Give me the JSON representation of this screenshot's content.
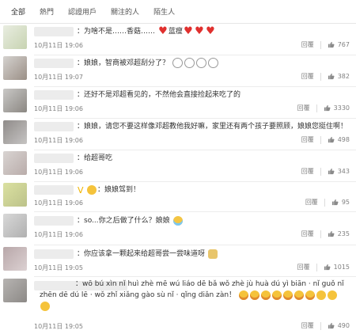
{
  "tabs": [
    "全部",
    "熱門",
    "認證用戶",
    "關注的人",
    "陌生人"
  ],
  "actions": {
    "reply_label": "回覆"
  },
  "comments": [
    {
      "text": "：为啥不是……香菇……",
      "suffix": "蓝瘦",
      "time": "10月11日 19:06",
      "likes": "767",
      "avatar_colors": [
        "#e9ede1",
        "#c7d3b1"
      ]
    },
    {
      "text": "：娘娘，智商被邓超刮分了？",
      "time": "10月11日 19:07",
      "likes": "382",
      "avatar_colors": [
        "#d5d2cf",
        "#9a8f86"
      ]
    },
    {
      "text": "：还好不是邓超看见的，不然他会直接捡起来吃了的",
      "time": "10月11日 19:06",
      "likes": "3330",
      "avatar_colors": [
        "#c9c8c6",
        "#8b8782"
      ]
    },
    {
      "text": "：娘娘，请您不要这样像邓超教他我好嘛，家里还有两个孩子要照顾，娘娘您挺住啊！",
      "time": "10月11日 19:06",
      "likes": "498",
      "avatar_colors": [
        "#8f8b89",
        "#c6c4c3"
      ]
    },
    {
      "text": "：给超哥吃",
      "time": "10月11日 19:06",
      "likes": "343",
      "avatar_colors": [
        "#d9d4d2",
        "#b9acaa"
      ]
    },
    {
      "text": "：娘娘驾到！",
      "time": "10月11日 19:06",
      "likes": "95",
      "avatar_colors": [
        "#dbe1a1",
        "#bcc28a"
      ]
    },
    {
      "text": "：so...你之后做了什么？娘娘",
      "time": "10月11日 19:06",
      "likes": "235",
      "avatar_colors": [
        "#d8d8d8",
        "#b0b0b0"
      ]
    },
    {
      "text": "：你应该拿一颗起来给超哥尝一尝味道呀",
      "time": "10月11日 19:05",
      "likes": "1015",
      "avatar_colors": [
        "#b8a7a9",
        "#dcd1d2"
      ]
    },
    {
      "text": "：wō bú xìn nǐ huì zhè mē wú liáo dē bǎ wǒ zhè jù huà dú yì biān · nǐ guǒ nǐ zhēn dē dú lē · wǒ zhǐ xiǎng gào sù nǐ · qǐng diǎn zàn！",
      "time": "10月11日 19:05",
      "likes": "490",
      "avatar_colors": [
        "#b7b4b2",
        "#8c8986"
      ]
    }
  ],
  "icons": {
    "heart": "heart-icon",
    "thumb": "thumbs-up-icon"
  }
}
